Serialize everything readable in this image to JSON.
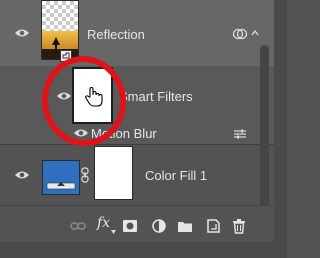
{
  "layers": {
    "reflection": {
      "name": "Reflection"
    },
    "smart_filters": {
      "name": "Smart Filters"
    },
    "motion_blur": {
      "name": "Motion Blur"
    },
    "color_fill": {
      "name": "Color Fill 1"
    }
  },
  "toolbar": {
    "fx_label": "fx"
  },
  "colors": {
    "panel_bg": "#535353",
    "selected_row_bg": "#676767",
    "highlight_ring": "#e0131b",
    "color_fill_swatch": "#2f6fc0",
    "text": "#e6e6e6"
  },
  "icons": {
    "visibility": "eye-icon",
    "smart_object_badge": "smart-object-icon",
    "link": "chain-link-icon",
    "filter_options": "filter-blending-options-icon",
    "cursor": "hand-cursor-icon"
  }
}
